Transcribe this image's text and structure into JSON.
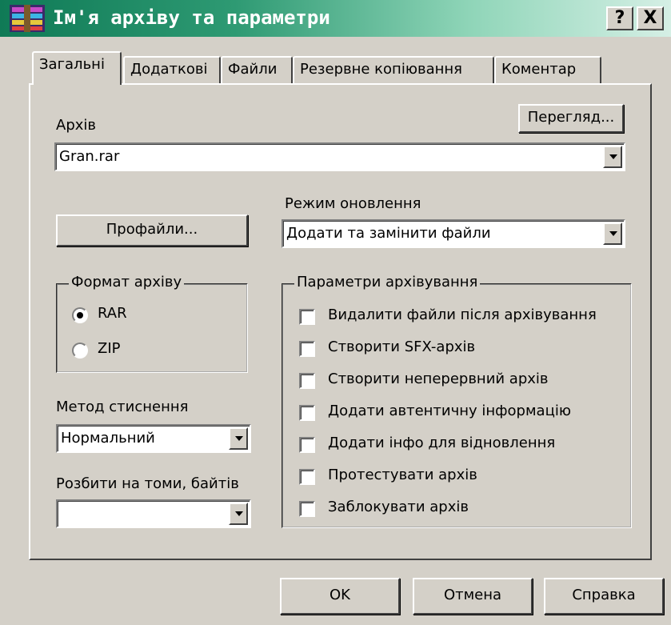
{
  "window": {
    "title": "Ім'я архіву та параметри",
    "help_btn": "?",
    "close_btn": "X"
  },
  "tabs": [
    {
      "label": "Загальні"
    },
    {
      "label": "Додаткові"
    },
    {
      "label": "Файли"
    },
    {
      "label": "Резервне копіювання"
    },
    {
      "label": "Коментар"
    }
  ],
  "general": {
    "archive_label": "Архів",
    "browse_button": "Перегляд...",
    "archive_value": "Gran.rar",
    "profiles_button": "Профайли...",
    "update_mode_label": "Режим оновлення",
    "update_mode_value": "Додати та замінити файли",
    "format_group": "Формат архіву",
    "format_options": [
      {
        "label": "RAR",
        "selected": true
      },
      {
        "label": "ZIP",
        "selected": false
      }
    ],
    "method_label": "Метод стиснення",
    "method_value": "Нормальний",
    "split_label": "Розбити на томи, байтів",
    "split_value": "",
    "options_group": "Параметри архівування",
    "options": [
      {
        "label": "Видалити файли після архівування",
        "checked": false
      },
      {
        "label": "Створити SFX-архів",
        "checked": false
      },
      {
        "label": "Створити неперервний архів",
        "checked": false
      },
      {
        "label": "Додати автентичну інформацію",
        "checked": false
      },
      {
        "label": "Додати інфо для відновлення",
        "checked": false
      },
      {
        "label": "Протестувати архів",
        "checked": false
      },
      {
        "label": "Заблокувати архів",
        "checked": false
      }
    ]
  },
  "footer": {
    "ok": "OK",
    "cancel": "Отмена",
    "help": "Справка"
  },
  "colors": {
    "title_start": "#0f7a56",
    "title_end": "#d5efe5",
    "face": "#d4d0c8"
  }
}
